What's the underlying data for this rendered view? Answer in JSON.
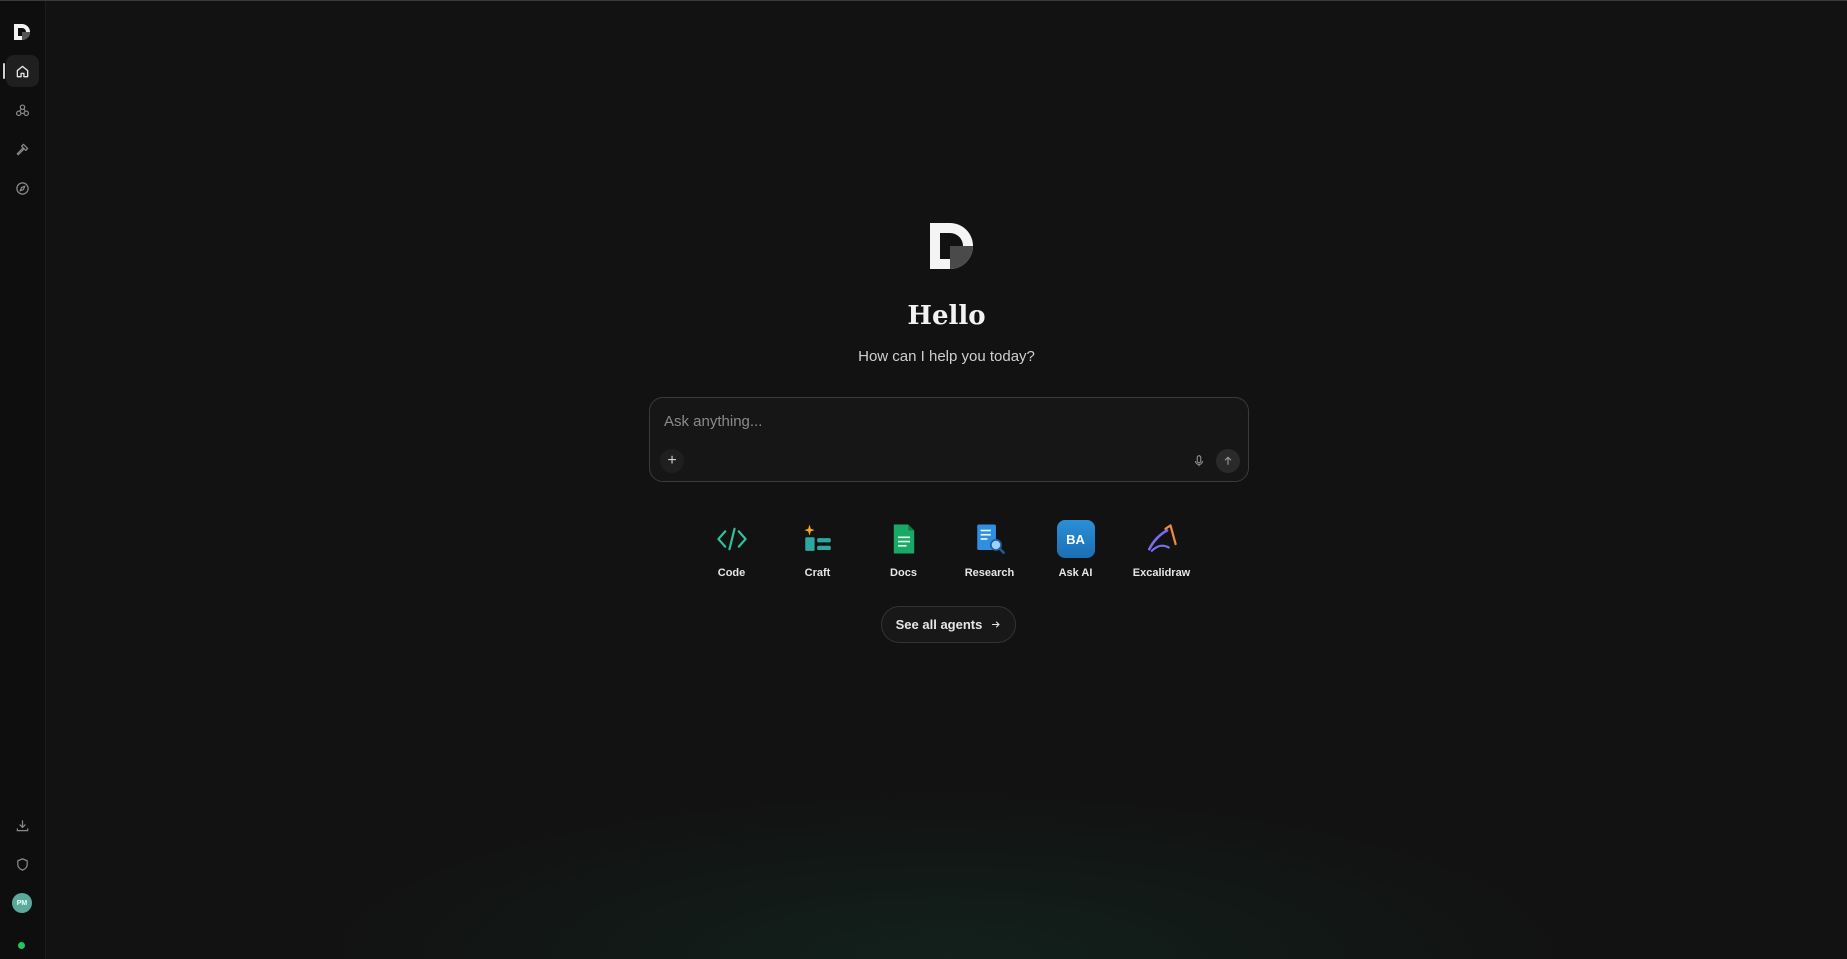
{
  "sidebar": {
    "logo": "D",
    "nav_items": [
      {
        "id": "home",
        "icon": "home-icon",
        "active": true
      },
      {
        "id": "agents",
        "icon": "agents-icon",
        "active": false
      },
      {
        "id": "tools",
        "icon": "hammer-icon",
        "active": false
      },
      {
        "id": "explore",
        "icon": "compass-icon",
        "active": false
      }
    ],
    "bottom_items": [
      {
        "id": "download",
        "icon": "download-icon"
      },
      {
        "id": "privacy",
        "icon": "shield-icon"
      }
    ],
    "avatar_initials": "PM",
    "status_color": "#22c55e"
  },
  "main": {
    "title": "Hello",
    "subtitle": "How can I help you today?",
    "composer": {
      "placeholder": "Ask anything...",
      "value": ""
    },
    "agents": [
      {
        "label": "Code",
        "icon": "code-icon"
      },
      {
        "label": "Craft",
        "icon": "craft-icon"
      },
      {
        "label": "Docs",
        "icon": "docs-icon"
      },
      {
        "label": "Research",
        "icon": "research-icon"
      },
      {
        "label": "Ask AI",
        "icon": "ask-ai-icon",
        "badge": "BA"
      },
      {
        "label": "Excalidraw",
        "icon": "excalidraw-icon"
      }
    ],
    "see_all_label": "See all agents"
  },
  "colors": {
    "background": "#121212",
    "accent_green": "#22c55e",
    "code_teal": "#2fbf9b",
    "docs_green": "#1aa867",
    "research_blue": "#2f8fe0"
  }
}
